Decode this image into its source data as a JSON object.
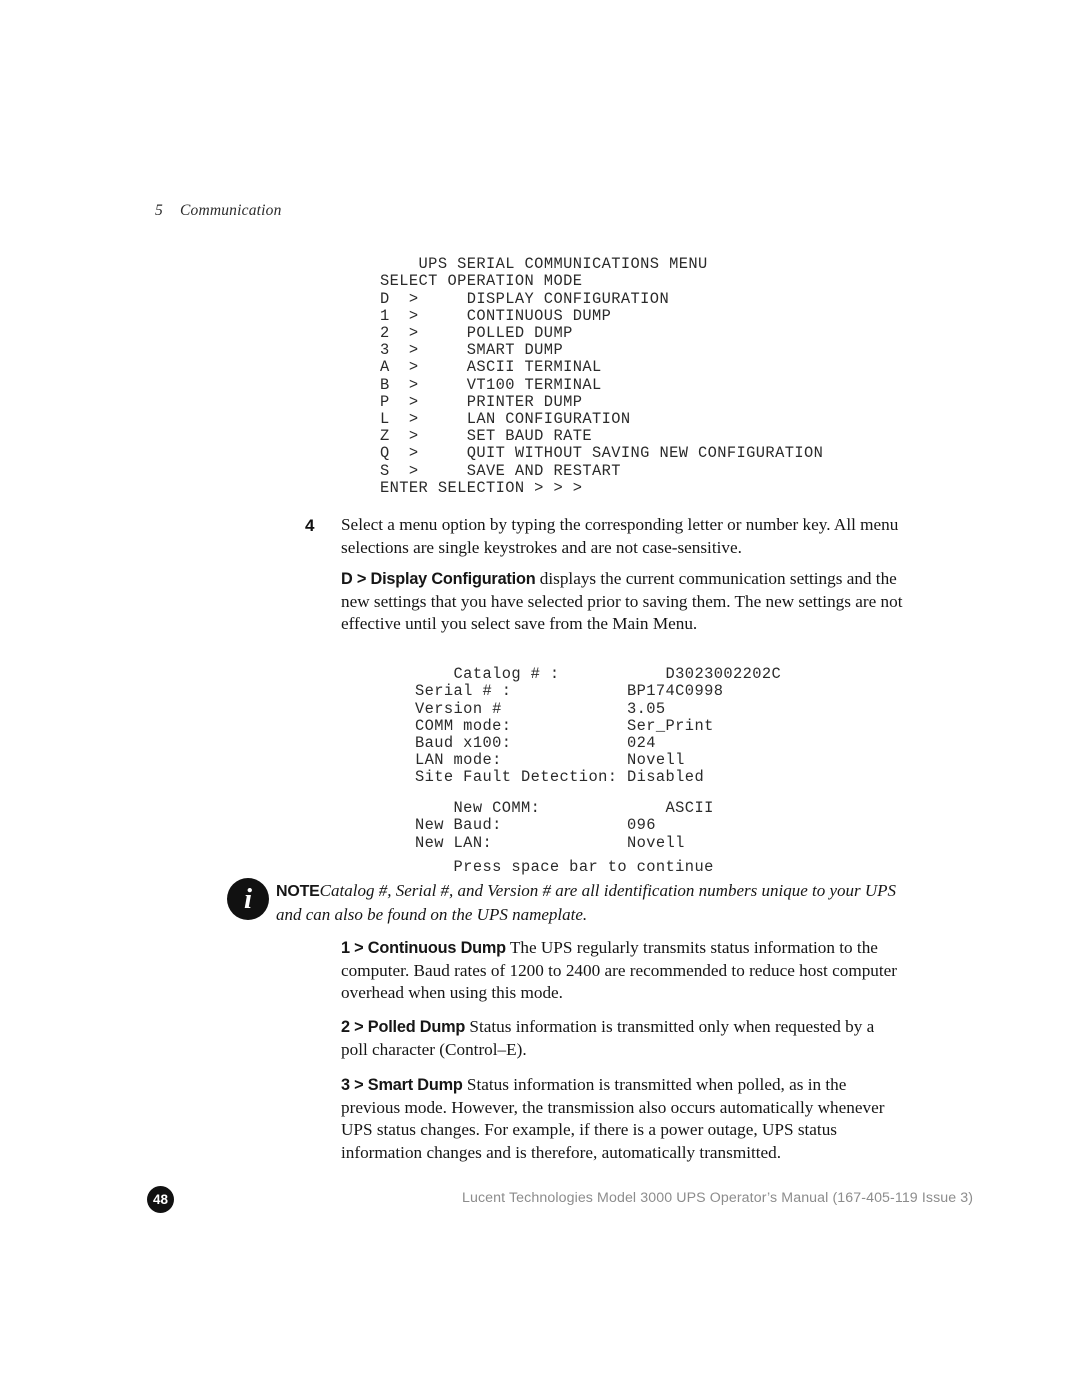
{
  "running_head": {
    "chapter_number": "5",
    "chapter_title": "Communication"
  },
  "terminal_menu": {
    "lines": [
      "UPS SERIAL COMMUNICATIONS MENU",
      "SELECT OPERATION MODE",
      "D  >     DISPLAY CONFIGURATION",
      "1  >     CONTINUOUS DUMP",
      "2  >     POLLED DUMP",
      "3  >     SMART DUMP",
      "A  >     ASCII TERMINAL",
      "B  >     VT100 TERMINAL",
      "P  >     PRINTER DUMP",
      "L  >     LAN CONFIGURATION",
      "Z  >     SET BAUD RATE",
      "Q  >     QUIT WITHOUT SAVING NEW CONFIGURATION",
      "S  >     SAVE AND RESTART",
      "ENTER SELECTION > > >"
    ],
    "title": "UPS SERIAL COMMUNICATIONS MENU",
    "subtitle": "SELECT OPERATION MODE",
    "options": [
      {
        "key": "D",
        "label": "DISPLAY CONFIGURATION"
      },
      {
        "key": "1",
        "label": "CONTINUOUS DUMP"
      },
      {
        "key": "2",
        "label": "POLLED DUMP"
      },
      {
        "key": "3",
        "label": "SMART DUMP"
      },
      {
        "key": "A",
        "label": "ASCII TERMINAL"
      },
      {
        "key": "B",
        "label": "VT100 TERMINAL"
      },
      {
        "key": "P",
        "label": "PRINTER DUMP"
      },
      {
        "key": "L",
        "label": "LAN CONFIGURATION"
      },
      {
        "key": "Z",
        "label": "SET BAUD RATE"
      },
      {
        "key": "Q",
        "label": "QUIT WITHOUT SAVING NEW CONFIGURATION"
      },
      {
        "key": "S",
        "label": "SAVE AND RESTART"
      }
    ],
    "prompt": "ENTER SELECTION > > >"
  },
  "terminal_config": {
    "lines": [
      "Catalog # :           D3023002202C",
      "Serial # :            BP174C0998",
      "Version #             3.05",
      "COMM mode:            Ser_Print",
      "Baud x100:            024",
      "LAN mode:             Novell",
      "Site Fault Detection: Disabled"
    ],
    "rows": [
      {
        "label": "Catalog # :",
        "value": "D3023002202C"
      },
      {
        "label": "Serial # :",
        "value": "BP174C0998"
      },
      {
        "label": "Version #",
        "value": "3.05"
      },
      {
        "label": "COMM mode:",
        "value": "Ser_Print"
      },
      {
        "label": "Baud x100:",
        "value": "024"
      },
      {
        "label": "LAN mode:",
        "value": "Novell"
      },
      {
        "label": "Site Fault Detection:",
        "value": "Disabled"
      }
    ]
  },
  "terminal_new_config": {
    "lines": [
      "New COMM:             ASCII",
      "New Baud:             096",
      "New LAN:              Novell"
    ],
    "rows": [
      {
        "label": "New COMM:",
        "value": "ASCII"
      },
      {
        "label": "New Baud:",
        "value": "096"
      },
      {
        "label": "New LAN:",
        "value": "Novell"
      }
    ]
  },
  "terminal_continue": {
    "text": "Press space bar to continue"
  },
  "step4": {
    "number": "4",
    "text": "Select a menu option by typing the corresponding letter or number key. All menu selections are single keystrokes and are not case-sensitive."
  },
  "display_config_para": {
    "lead": "D > Display Configuration",
    "text": " displays the current communication settings and the new settings that you have selected prior to saving them. The new settings are not effective until you select save from the Main Menu."
  },
  "note": {
    "icon": "info-icon",
    "icon_glyph": "i",
    "label": "NOTE",
    "text": "Catalog #, Serial #, and Version # are all identification numbers unique to your UPS and can also be found on the UPS nameplate."
  },
  "continuous_dump_para": {
    "lead": "1 > Continuous Dump",
    "text": " The UPS regularly transmits status information to the computer. Baud rates of 1200 to 2400 are recommended to reduce host computer overhead when using this mode."
  },
  "polled_dump_para": {
    "lead": "2 > Polled Dump",
    "text": " Status information is transmitted only when requested by a poll character (Control–E)."
  },
  "smart_dump_para": {
    "lead": "3 > Smart Dump",
    "text": " Status information is transmitted when polled, as in the previous mode. However, the transmission also occurs automatically whenever UPS status changes. For example, if there is a power outage, UPS status information changes and is therefore, automatically transmitted."
  },
  "footer": {
    "page_number": "48",
    "text": "Lucent Technologies Model 3000 UPS Operator’s Manual (167-405-119 Issue 3)"
  },
  "colors": {
    "text": "#161616",
    "terminal_text": "#2a2a2a",
    "footer_text": "#8c8c8c",
    "badge_bg": "#111111",
    "page_bg": "#ffffff"
  }
}
